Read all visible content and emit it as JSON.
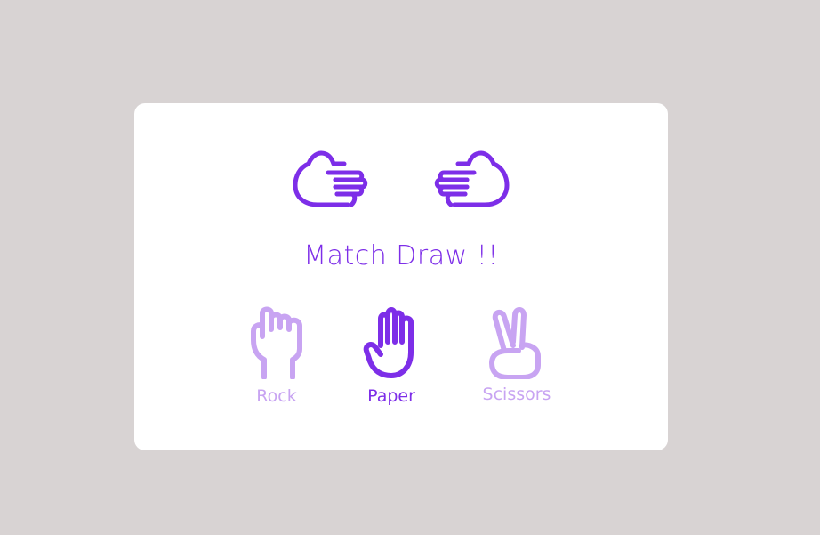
{
  "game": {
    "result_text": "Match Draw !!",
    "player_hand": "paper-hand-pointing-right",
    "computer_hand": "paper-hand-pointing-left"
  },
  "choices": [
    {
      "label": "Rock",
      "icon": "rock-fist-icon",
      "selected": false
    },
    {
      "label": "Paper",
      "icon": "paper-hand-icon",
      "selected": true
    },
    {
      "label": "Scissors",
      "icon": "scissors-hand-icon",
      "selected": false
    }
  ],
  "colors": {
    "background": "#d8d3d3",
    "card": "#ffffff",
    "accent": "#7d2ee8",
    "inactive": "#c8a4f2"
  }
}
